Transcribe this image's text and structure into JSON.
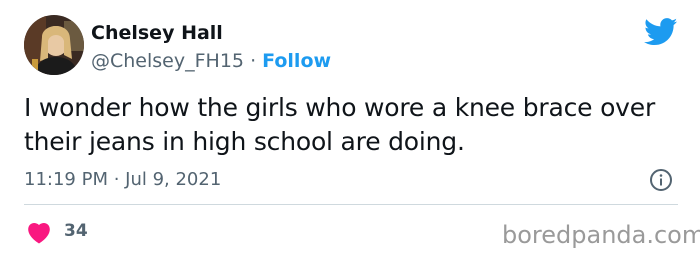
{
  "user": {
    "display_name": "Chelsey Hall",
    "handle": "@Chelsey_FH15",
    "separator": "·",
    "follow_label": "Follow"
  },
  "tweet": {
    "text": "I wonder how the girls who wore a knee brace over their jeans in high school are doing.",
    "timestamp": "11:19 PM · Jul 9, 2021"
  },
  "engagement": {
    "likes": "34"
  },
  "watermark": "boredpanda.com",
  "icons": {
    "brand": "twitter-bird-icon",
    "info": "info-icon",
    "like": "heart-icon"
  },
  "colors": {
    "twitter_blue": "#1d9bf0",
    "heart_red": "#f91880",
    "secondary_text": "#536471",
    "primary_text": "#0f1419"
  }
}
